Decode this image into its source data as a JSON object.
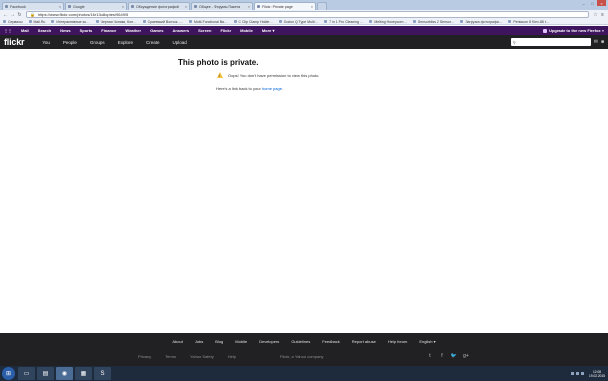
{
  "browser": {
    "tabs": [
      {
        "label": "Facebook"
      },
      {
        "label": "Google"
      },
      {
        "label": "Обсуждение фотографий"
      },
      {
        "label": "Общее - Форумы Пакета"
      },
      {
        "label": "Flickr: Private page",
        "active": true
      }
    ],
    "url": "https://www.flickr.com/photos/16r13u8optes/9649/5",
    "bookmarks": [
      "Сервисы",
      "Mail.Ru",
      "Интерактивные ко…",
      "Черная Чопики, Кон…",
      "Сраевский Волчок -…",
      "Multi-Functional Ba…",
      "C Clip Clamp Holde…",
      "Godox Q Type Multi…",
      "7 in 1 Pro Cleaning …",
      "Melting Honeycom…",
      "Sensorbliss 2 Sensor…",
      "Загрузка фотографи…",
      "Pentacon 8 Kiev-88 t…"
    ]
  },
  "yahoo_bar": {
    "items": [
      "Mail",
      "Search",
      "News",
      "Sports",
      "Finance",
      "Weather",
      "Games",
      "Answers",
      "Screen",
      "Flickr",
      "Mobile",
      "More ▾"
    ],
    "right": "Upgrade to the new Firefox »"
  },
  "flickr": {
    "logo": "flickr",
    "nav": [
      "You",
      "People",
      "Groups",
      "Explore",
      "Create",
      "Upload"
    ],
    "page_title": "This photo is private.",
    "message": "Oops! You don't have permission to view this photo.",
    "link_prefix": "Here's a link back to your ",
    "link_text": "home page",
    "link_suffix": "."
  },
  "footer": {
    "links": [
      "About",
      "Jobs",
      "Blog",
      "Mobile",
      "Developers",
      "Guidelines",
      "Feedback",
      "Report abuse",
      "Help forum",
      "English ▾"
    ],
    "legal": [
      "Privacy",
      "Terms",
      "Yahoo Safety",
      "Help"
    ],
    "copyright": "Flickr, a Yahoo company",
    "social": [
      "t",
      "f",
      "twitter",
      "g+"
    ]
  },
  "taskbar": {
    "time": "12:08",
    "date": "19.02.2015"
  },
  "colors": {
    "yahoo_purple": "#3f145f",
    "flickr_dark": "#212124",
    "link_blue": "#0063dc",
    "warning": "#f3c23f"
  }
}
